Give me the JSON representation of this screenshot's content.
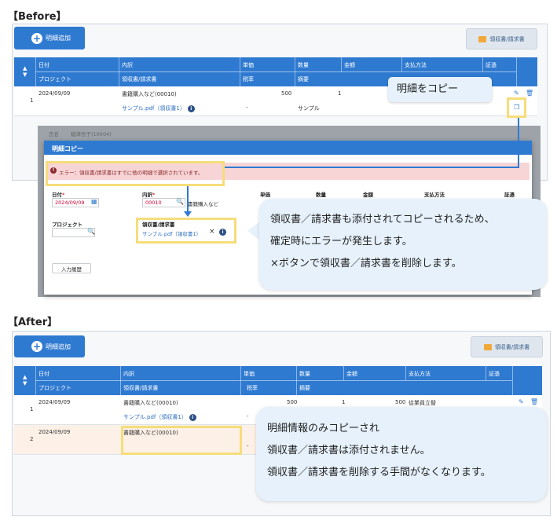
{
  "labels": {
    "before": "【Before】",
    "after": "【After】"
  },
  "toolbar": {
    "add_label": "明細追加",
    "receipt_label": "領収書/請求書"
  },
  "table": {
    "header_row1": [
      "日付",
      "内訳",
      "単価",
      "数量",
      "金額",
      "支払方法",
      "証憑"
    ],
    "header_row2": [
      "プロジェクト",
      "領収書/請求書",
      "税率",
      "摘要"
    ]
  },
  "before": {
    "row1": {
      "no": "1",
      "date": "2024/09/09",
      "detail": "書籍購入など(00010)",
      "price": "500",
      "qty": "1",
      "file": "サンプル.pdf（領収書1）",
      "tax": "-",
      "memo": "サンプル"
    },
    "faded_row": {
      "c1": "氏名",
      "c2": "稲津吾子(10004)"
    },
    "tooltip": "明細をコピー",
    "modal": {
      "title": "明細コピー",
      "error": "エラー：領収書/請求書はすでに他の明細で選択されています。",
      "date_label": "日付",
      "date_value": "2024/09/09",
      "detail_label": "内訳",
      "detail_code": "00010",
      "detail_name": "書籍購入など",
      "price_label": "単価",
      "qty_label": "数量",
      "amount_label": "金額",
      "pay_label": "支払方法",
      "evidence_label": "証憑",
      "project_label": "プロジェクト",
      "receipt_label": "領収書/請求書",
      "receipt_file": "サンプル.pdf（領収書1）",
      "history_button": "入力履歴"
    },
    "callout": [
      "領収書／請求書も添付されてコピーされるため、",
      "確定時にエラーが発生します。",
      "×ボタンで領収書／請求書を削除します。"
    ]
  },
  "after": {
    "row1": {
      "no": "1",
      "date": "2024/09/09",
      "detail": "書籍購入など(00010)",
      "price": "500",
      "qty": "1",
      "amount": "500",
      "pay": "従業員立替",
      "file": "サンプル.pdf（領収書1）",
      "tax": "-"
    },
    "row2": {
      "no": "2",
      "date": "2024/09/09",
      "detail": "書籍購入など(00010)",
      "tax": "-"
    },
    "callout": [
      "明細情報のみコピーされ",
      "領収書／請求書は添付されません。",
      "領収書／請求書を削除する手間がなくなります。"
    ]
  },
  "icons": {
    "plus": "+",
    "sort_up": "▲",
    "sort_down": "▼",
    "edit": "✎",
    "trash": "🗑",
    "copy": "❐",
    "info": "i",
    "search": "🔍",
    "calendar": "▦",
    "close": "×"
  },
  "colors": {
    "primary": "#2f7ad1",
    "highlight": "#f6dd7a",
    "error_bg": "#f7d4d6",
    "callout_bg": "#e6f1fb",
    "copied_row": "#fdf1e7"
  }
}
